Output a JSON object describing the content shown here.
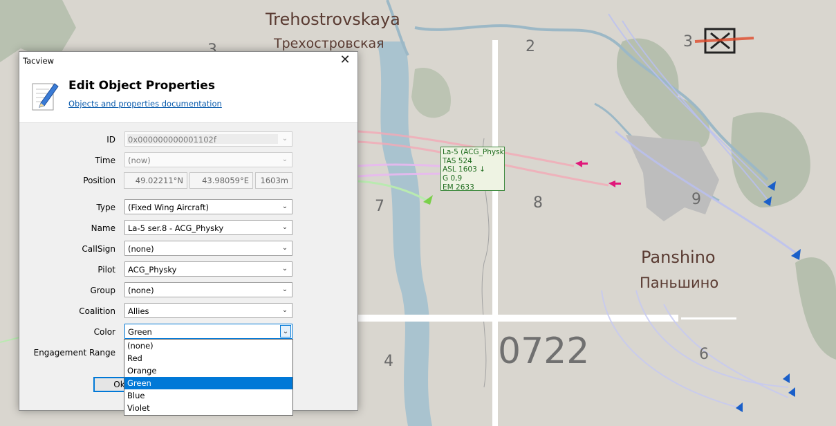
{
  "map": {
    "towns": [
      {
        "latin": "Trehostrovskaya",
        "cyrillic": "Трехостровская"
      },
      {
        "latin": "Panshino",
        "cyrillic": "Паньшино"
      }
    ],
    "grid_numbers": [
      "3",
      "2",
      "3",
      "7",
      "8",
      "9",
      "4",
      "6"
    ],
    "big_number": "0722",
    "object_label": {
      "lines": [
        "La-5 (ACG_Physky)",
        "TAS 524",
        "ASL 1603 ↓",
        "G 0,9",
        "EM 2633"
      ],
      "color": "#1d6b1d"
    }
  },
  "dialog": {
    "window_title": "Tacview",
    "close_symbol": "✕",
    "heading": "Edit Object Properties",
    "doc_link": "Objects and properties documentation",
    "fields": {
      "id": {
        "label": "ID",
        "value": "0x000000000001102f"
      },
      "time": {
        "label": "Time",
        "value": "(now)"
      },
      "position": {
        "label": "Position",
        "lat": "49.02211°N",
        "lon": "43.98059°E",
        "alt": "1603m"
      },
      "type": {
        "label": "Type",
        "value": "(Fixed Wing Aircraft)"
      },
      "name": {
        "label": "Name",
        "value": "La-5 ser.8 - ACG_Physky"
      },
      "callsign": {
        "label": "CallSign",
        "value": "(none)"
      },
      "pilot": {
        "label": "Pilot",
        "value": "ACG_Physky"
      },
      "group": {
        "label": "Group",
        "value": "(none)"
      },
      "coalition": {
        "label": "Coalition",
        "value": "Allies"
      },
      "color": {
        "label": "Color",
        "value": "Green"
      },
      "engagement_range": {
        "label": "Engagement Range"
      }
    },
    "ok_button": "Ok",
    "color_options": [
      "(none)",
      "Red",
      "Orange",
      "Green",
      "Blue",
      "Violet"
    ],
    "selected_color": "Green",
    "accent": "#0078d7"
  }
}
